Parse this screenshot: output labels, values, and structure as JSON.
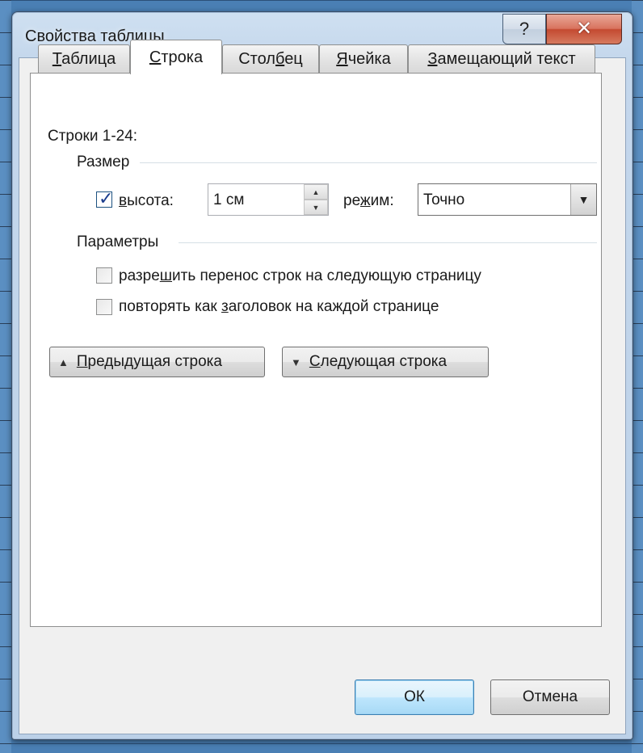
{
  "window": {
    "title": "Свойства таблицы",
    "help_label": "?",
    "close_label": "✕"
  },
  "tabs": [
    {
      "label": "Таблица",
      "accel": "Т",
      "rest": "аблица",
      "active": false
    },
    {
      "label": "Строка",
      "accel": "С",
      "rest": "трока",
      "active": true
    },
    {
      "label": "Столбец",
      "pre": "Стол",
      "accel": "б",
      "rest": "ец",
      "active": false
    },
    {
      "label": "Ячейка",
      "accel": "Я",
      "rest": "чейка",
      "active": false
    },
    {
      "label": "Замещающий текст",
      "accel": "З",
      "rest": "амещающий текст",
      "active": false
    }
  ],
  "rows_label": "Строки 1-24:",
  "size_group": {
    "title": "Размер",
    "height_checkbox": {
      "checked": true,
      "accel": "в",
      "rest": "ысота:"
    },
    "height_value": "1 см",
    "mode_label": {
      "pre": "ре",
      "accel": "ж",
      "rest": "им:"
    },
    "mode_value": "Точно"
  },
  "params_group": {
    "title": "Параметры",
    "allow_break": {
      "checked": false,
      "pre": "разре",
      "accel": "ш",
      "rest": "ить перенос строк на следующую страницу"
    },
    "repeat_header": {
      "checked": false,
      "pre": "повторять как ",
      "accel": "з",
      "rest": "аголовок на каждой странице"
    }
  },
  "nav": {
    "prev": {
      "accel": "П",
      "rest": "редыдущая строка"
    },
    "next": {
      "accel": "С",
      "rest": "ледующая строка"
    }
  },
  "buttons": {
    "ok": "ОК",
    "cancel": "Отмена"
  }
}
